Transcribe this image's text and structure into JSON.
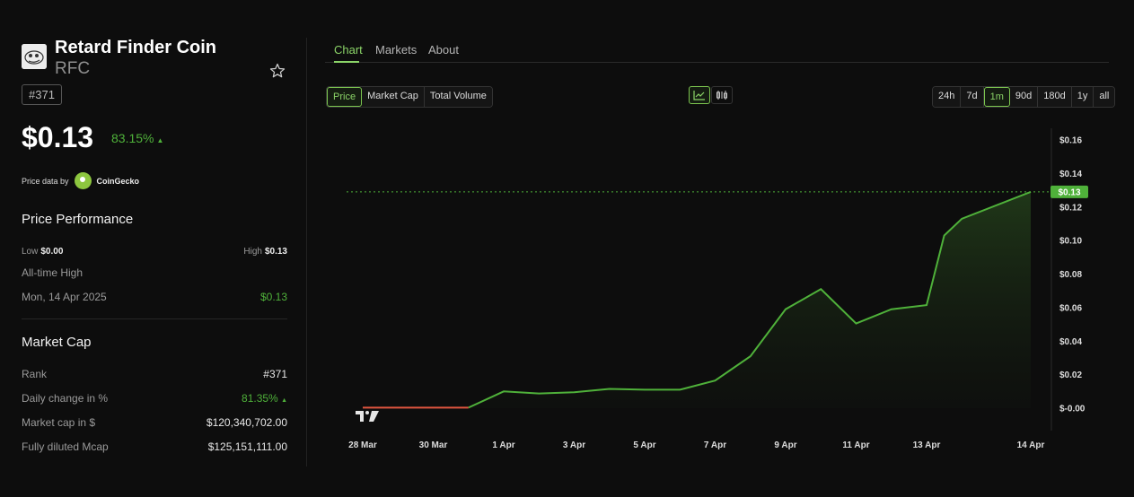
{
  "coin": {
    "name": "Retard Finder Coin",
    "symbol": "RFC",
    "rank_badge": "#371",
    "price": "$0.13",
    "change": "83.15%",
    "price_data_by": "Price data by",
    "provider": "CoinGecko"
  },
  "price_performance": {
    "title": "Price Performance",
    "low_label": "Low",
    "low_value": "$0.00",
    "high_label": "High",
    "high_value": "$0.13",
    "ath_label": "All-time High",
    "ath_date": "Mon, 14 Apr 2025",
    "ath_value": "$0.13"
  },
  "market_cap": {
    "title": "Market Cap",
    "rows": [
      {
        "label": "Rank",
        "value": "#371"
      },
      {
        "label": "Daily change in %",
        "value": "81.35%"
      },
      {
        "label": "Market cap in $",
        "value": "$120,340,702.00"
      },
      {
        "label": "Fully diluted Mcap",
        "value": "$125,151,111.00"
      }
    ]
  },
  "tabs": [
    "Chart",
    "Markets",
    "About"
  ],
  "metric_buttons": [
    "Price",
    "Market Cap",
    "Total Volume"
  ],
  "range_buttons": [
    "24h",
    "7d",
    "1m",
    "90d",
    "180d",
    "1y",
    "all"
  ],
  "active_range": "1m",
  "icons": {
    "favorite": "star-icon",
    "line_chart": "line-chart-icon",
    "candles": "candlestick-icon",
    "watermark": "tradingview-logo"
  },
  "colors": {
    "accent": "#8bd468",
    "line": "#4fb13a",
    "line_red": "#e0553f",
    "background": "#0d0d0d"
  },
  "chart_data": {
    "type": "line",
    "x": [
      "28 Mar",
      "29 Mar",
      "30 Mar",
      "31 Mar",
      "1 Apr",
      "2 Apr",
      "3 Apr",
      "4 Apr",
      "5 Apr",
      "6 Apr",
      "7 Apr",
      "8 Apr",
      "9 Apr",
      "10 Apr",
      "11 Apr",
      "12 Apr",
      "13 Apr",
      "13 Apr",
      "14 Apr",
      "14 Apr"
    ],
    "y": [
      0.0003,
      0.0003,
      0.0003,
      0.0003,
      0.01,
      0.0088,
      0.0095,
      0.0115,
      0.011,
      0.011,
      0.0165,
      0.031,
      0.059,
      0.071,
      0.0505,
      0.059,
      0.0615,
      0.103,
      0.113,
      0.129
    ],
    "x_ticks": [
      "28 Mar",
      "30 Mar",
      "1 Apr",
      "3 Apr",
      "5 Apr",
      "7 Apr",
      "9 Apr",
      "11 Apr",
      "13 Apr",
      "14 Apr"
    ],
    "y_ticks": [
      "$0.16",
      "$0.14",
      "$0.12",
      "$0.10",
      "$0.08",
      "$0.06",
      "$0.04",
      "$0.02",
      "$-0.00"
    ],
    "ylim": [
      0,
      0.16
    ],
    "current_label": "$0.13",
    "current_value": 0.129
  }
}
